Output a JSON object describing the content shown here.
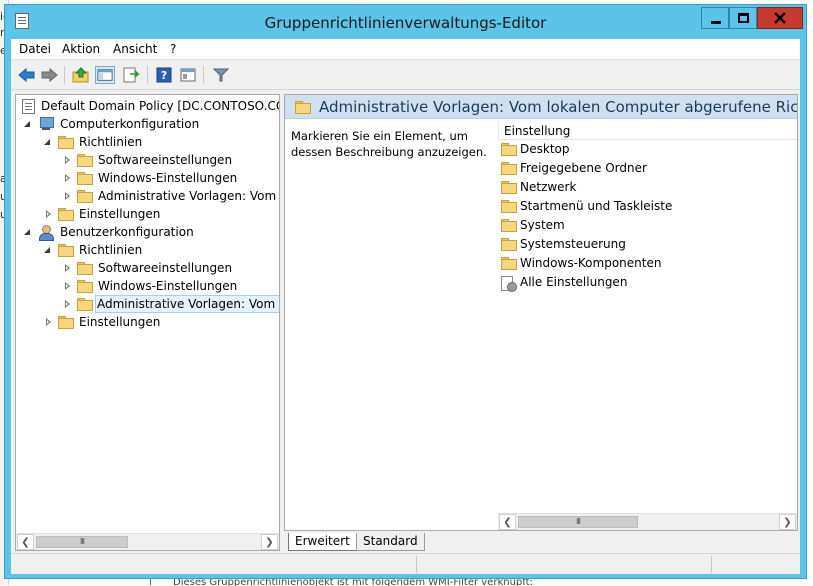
{
  "window": {
    "title": "Gruppenrichtlinienverwaltungs-Editor"
  },
  "menu": [
    "Datei",
    "Aktion",
    "Ansicht",
    "?"
  ],
  "toolbar": {
    "buttons": [
      "back-arrow-icon",
      "forward-arrow-icon",
      "up-folder-icon",
      "show-hide-tree-icon",
      "export-list-icon",
      "help-icon",
      "properties-icon",
      "filter-icon"
    ]
  },
  "tree": {
    "root": "Default Domain Policy [DC.CONTOSO.COM]",
    "computer": "Computerkonfiguration",
    "computer_richtlinien": "Richtlinien",
    "computer_software": "Softwareeinstellungen",
    "computer_windows": "Windows-Einstellungen",
    "computer_admin": "Administrative Vorlagen: Vom lokal",
    "computer_einstellungen": "Einstellungen",
    "user": "Benutzerkonfiguration",
    "user_richtlinien": "Richtlinien",
    "user_software": "Softwareeinstellungen",
    "user_windows": "Windows-Einstellungen",
    "user_admin": "Administrative Vorlagen: Vom loka",
    "user_einstellungen": "Einstellungen"
  },
  "right": {
    "header_title": "Administrative Vorlagen: Vom lokalen Computer abgerufene Richtliniend",
    "description": "Markieren Sie ein Element, um dessen Beschreibung anzuzeigen.",
    "column_header": "Einstellung",
    "items": [
      "Desktop",
      "Freigegebene Ordner",
      "Netzwerk",
      "Startmenü und Taskleiste",
      "System",
      "Systemsteuerung",
      "Windows-Komponenten",
      "Alle Einstellungen"
    ]
  },
  "tabs": [
    "Erweitert",
    "Standard"
  ],
  "background": {
    "left_fragments": [
      "ic",
      "nt",
      "e",
      "ar",
      "u",
      "u"
    ],
    "bottom_text": "Dieses Gruppenrichtlinienobjekt ist mit folgendem WMI-Filter verknüpft:"
  },
  "colors": {
    "titlebar": "#5bc4e8",
    "close_button": "#c7382d",
    "header_band": "#cfe0f2"
  }
}
